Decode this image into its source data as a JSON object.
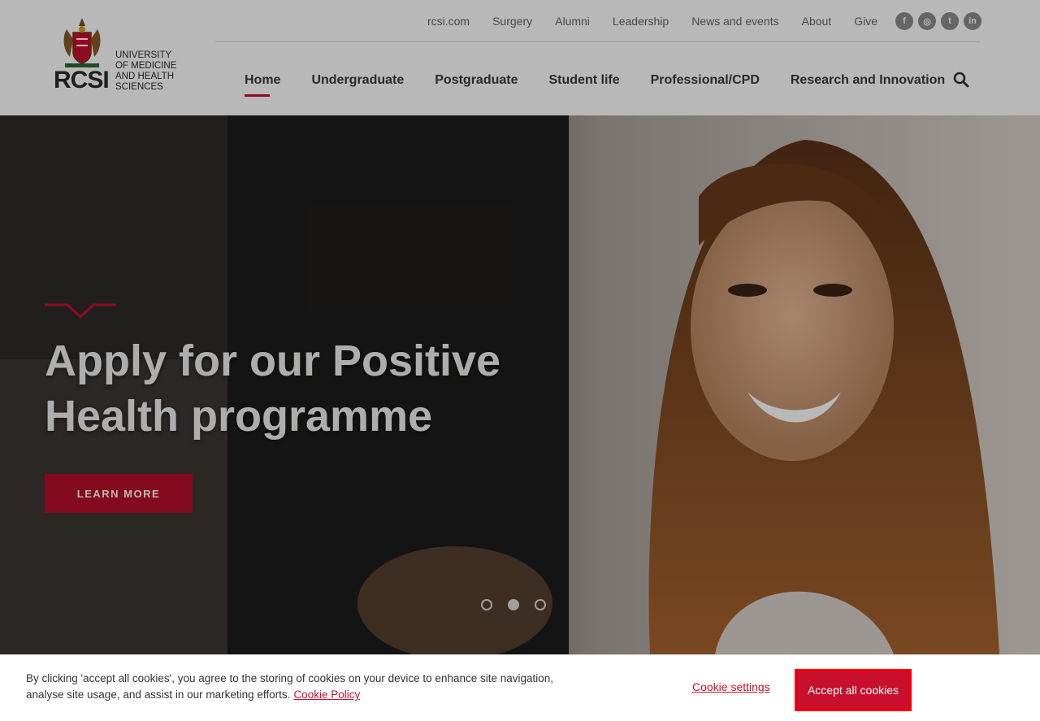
{
  "logo": {
    "short": "RCSI",
    "lines": [
      "UNIVERSITY",
      "OF MEDICINE",
      "AND HEALTH",
      "SCIENCES"
    ]
  },
  "utility_nav": [
    "rcsi.com",
    "Surgery",
    "Alumni",
    "Leadership",
    "News and events",
    "About",
    "Give"
  ],
  "social": [
    {
      "icon": "facebook-icon",
      "glyph": "f"
    },
    {
      "icon": "instagram-icon",
      "glyph": "◎"
    },
    {
      "icon": "twitter-icon",
      "glyph": "t"
    },
    {
      "icon": "linkedin-icon",
      "glyph": "in"
    }
  ],
  "main_nav": [
    "Home",
    "Undergraduate",
    "Postgraduate",
    "Student life",
    "Professional/CPD",
    "Research and Innovation"
  ],
  "hero": {
    "title_line1": "Apply for our Positive",
    "title_line2": "Health programme",
    "button": "LEARN MORE",
    "slides": 3,
    "active_slide": 2
  },
  "cookie": {
    "text": "By clicking 'accept all cookies', you agree to the storing of cookies on your device to enhance site navigation, analyse site usage, and assist in our marketing efforts.",
    "policy_link": "Cookie Policy",
    "settings": "Cookie settings",
    "accept": "Accept all cookies"
  },
  "colors": {
    "accent": "#c8102e"
  }
}
